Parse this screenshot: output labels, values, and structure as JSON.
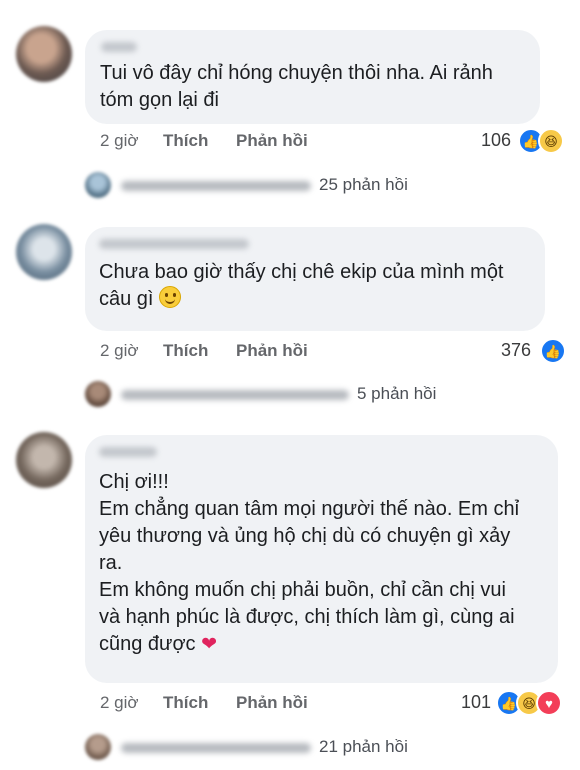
{
  "comments": [
    {
      "text": "Tui vô đây chỉ hóng chuyện thôi nha. Ai rảnh\ntóm gọn lại đi",
      "time": "2 giờ",
      "like_label": "Thích",
      "reply_label": "Phản hồi",
      "reaction_count": "106",
      "reactions": [
        "like-icon",
        "haha-icon"
      ],
      "replies_label": "25 phản hồi"
    },
    {
      "text": "Chưa bao giờ thấy chị chê ekip của mình một\ncâu gì",
      "time": "2 giờ",
      "like_label": "Thích",
      "reply_label": "Phản hồi",
      "reaction_count": "376",
      "reactions": [
        "like-icon"
      ],
      "replies_label": "5 phản hồi"
    },
    {
      "text_lines": [
        "Chị ơi!!!",
        "Em chẳng quan tâm mọi người thế nào. Em chỉ",
        "yêu thương và ủng hộ chị dù có chuyện gì xảy",
        "ra.",
        "Em không muốn chị phải buồn, chỉ cần chị vui",
        "và hạnh phúc là được, chị thích làm gì, cùng ai",
        "cũng được"
      ],
      "time": "2 giờ",
      "like_label": "Thích",
      "reply_label": "Phản hồi",
      "reaction_count": "101",
      "reactions": [
        "like-icon",
        "haha-icon",
        "love-icon"
      ],
      "replies_label": "21 phản hồi"
    }
  ],
  "colors": {
    "bubble": "#f0f2f5",
    "like_blue": "#1877f2",
    "haha_yellow": "#f7c948",
    "love_red": "#f33e58",
    "muted_text": "#65676b"
  }
}
